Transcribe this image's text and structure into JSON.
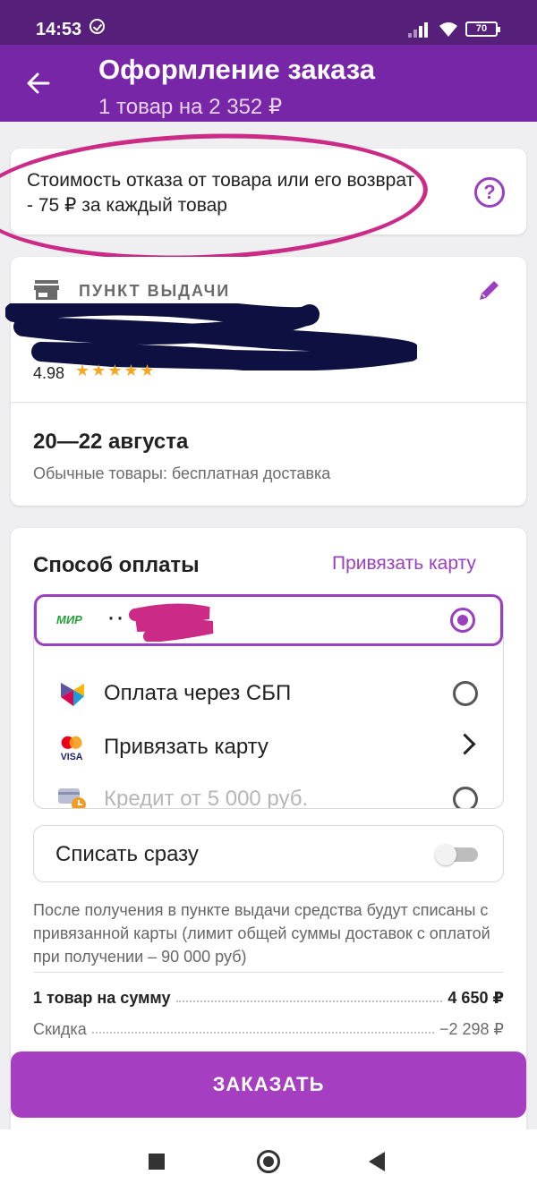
{
  "status_bar": {
    "time": "14:53",
    "battery": "70"
  },
  "header": {
    "title": "Оформление заказа",
    "subtitle": "1 товар на 2 352 ₽"
  },
  "notice": {
    "text": "Стоимость отказа от товара или его возврат - 75 ₽ за каждый товар"
  },
  "pickup": {
    "label": "ПУНКТ ВЫДАЧИ",
    "rating": "4.98",
    "stars": "★★★★★",
    "delivery_date": "20—22 августа",
    "delivery_note": "Обычные товары: бесплатная доставка"
  },
  "payment": {
    "heading": "Способ оплаты",
    "link_card": "Привязать карту",
    "selected_card": {
      "brand": "МИР",
      "masked": "··"
    },
    "options": [
      {
        "label": "Оплата через СБП"
      },
      {
        "label": "Привязать карту"
      },
      {
        "label": "Кредит от 5 000 руб."
      }
    ],
    "charge_now": "Списать сразу",
    "fine_print": "После получения в пункте выдачи средства будут списаны с привязанной карты (лимит общей суммы доставок с оплатой при получении – 90 000 руб)",
    "summary": [
      {
        "label": "1 товар на сумму",
        "value": "4 650 ₽"
      },
      {
        "label": "Скидка",
        "value": "−2 298 ₽"
      }
    ]
  },
  "order_button": "ЗАКАЗАТЬ",
  "colors": {
    "brand": "#7826a8",
    "accent": "#9a3fbf",
    "button": "#a53ec0",
    "annotation": "#cb2a86"
  }
}
